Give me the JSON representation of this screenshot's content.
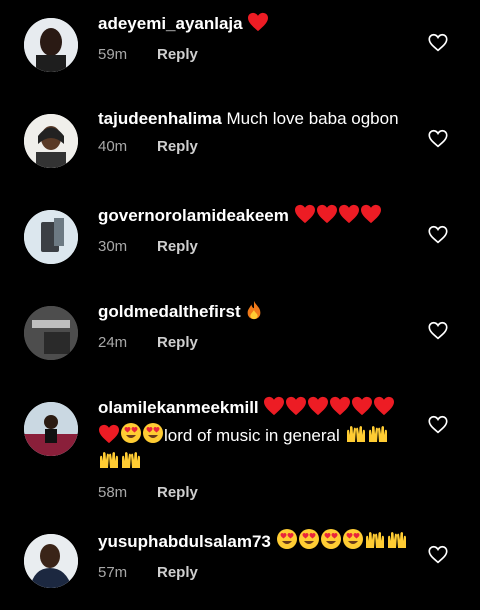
{
  "comments": [
    {
      "username": "adeyemi_ayanlaja",
      "text": "",
      "emojis": "❤",
      "time": "59m",
      "reply": "Reply"
    },
    {
      "username": "tajudeenhalima",
      "text": "Much love baba ogbon",
      "emojis": "",
      "time": "40m",
      "reply": "Reply"
    },
    {
      "username": "governorolamideakeem",
      "text": "",
      "emojis": "❤❤❤❤",
      "time": "30m",
      "reply": "Reply"
    },
    {
      "username": "goldmedalthefirst",
      "text": "",
      "emojis": "🔥",
      "time": "24m",
      "reply": "Reply"
    },
    {
      "username": "olamilekanmeekmill",
      "text": "lord of music in general",
      "emojis": "❤❤❤❤❤❤❤😍😍 🙌🙌🙌🙌",
      "time": "58m",
      "reply": "Reply"
    },
    {
      "username": "yusuphabdulsalam73",
      "text": "",
      "emojis": "😍😍😍😍🙌🙌",
      "time": "57m",
      "reply": "Reply"
    }
  ],
  "icons": {
    "like": "heart-outline-icon"
  },
  "colors": {
    "background": "#000000",
    "heart": "#ed1c24",
    "time": "#a8a8a8"
  }
}
